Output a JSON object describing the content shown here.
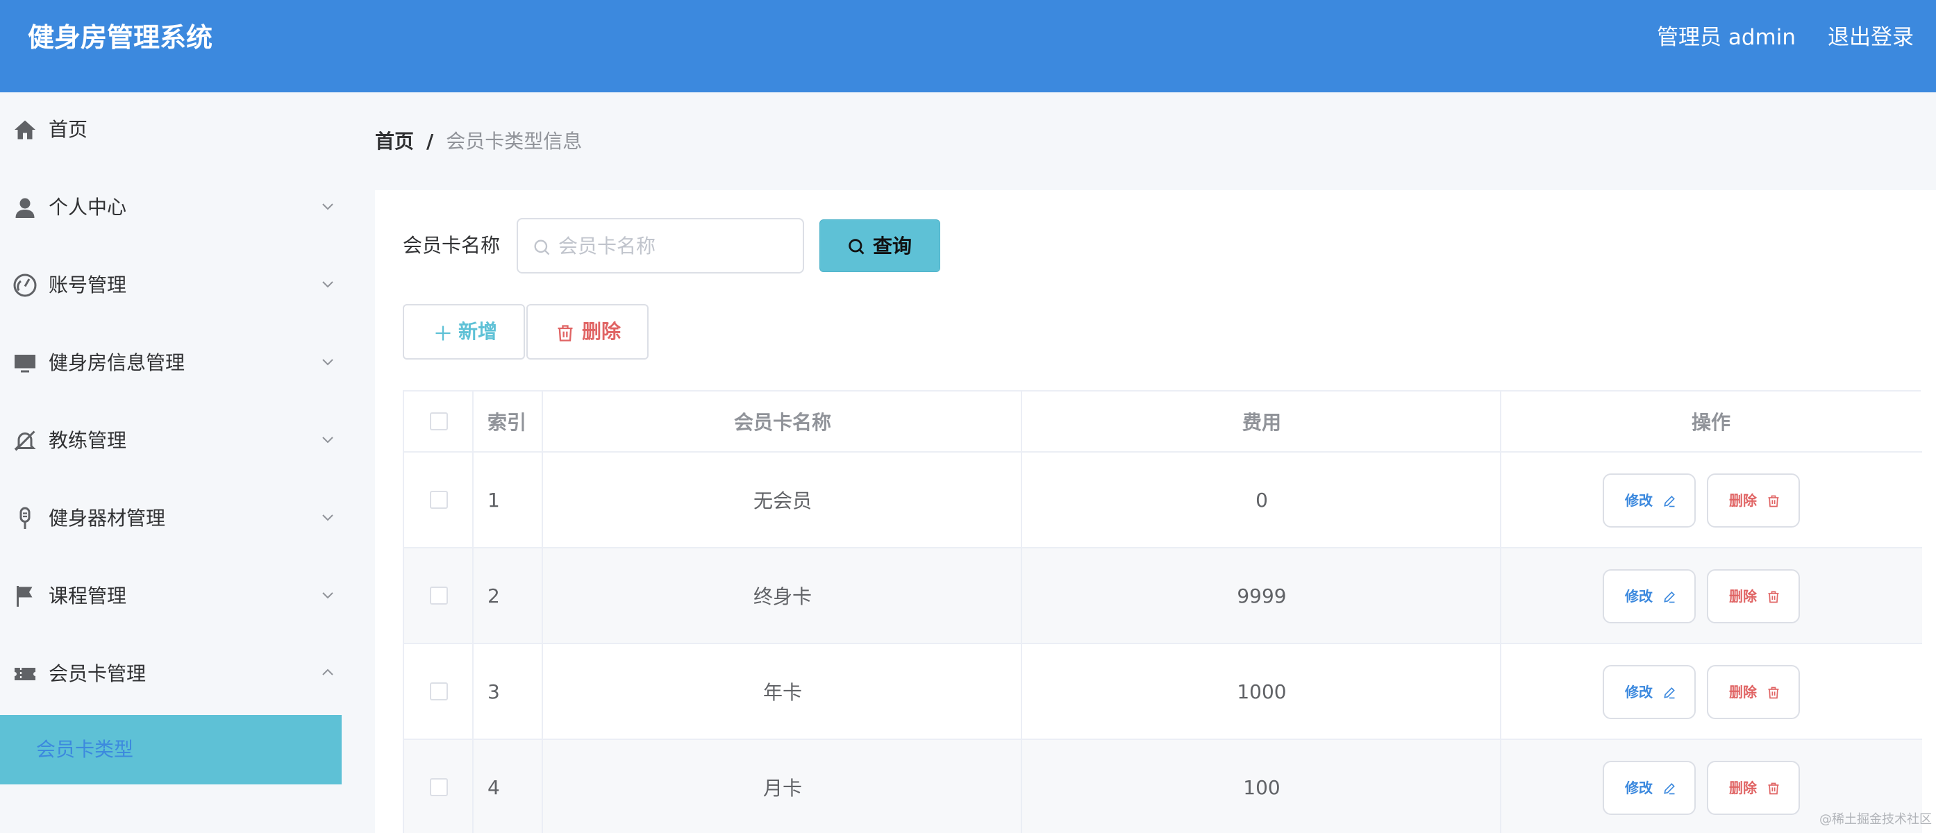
{
  "header": {
    "app_title": "健身房管理系统",
    "admin_label": "管理员 admin",
    "logout_label": "退出登录"
  },
  "sidebar": {
    "items": [
      {
        "label": "首页",
        "icon": "home-icon",
        "expandable": false
      },
      {
        "label": "个人中心",
        "icon": "user-icon",
        "expandable": true
      },
      {
        "label": "账号管理",
        "icon": "odometer-icon",
        "expandable": true
      },
      {
        "label": "健身房信息管理",
        "icon": "monitor-icon",
        "expandable": true
      },
      {
        "label": "教练管理",
        "icon": "bell-off-icon",
        "expandable": true
      },
      {
        "label": "健身器材管理",
        "icon": "microphone-icon",
        "expandable": true
      },
      {
        "label": "课程管理",
        "icon": "flag-icon",
        "expandable": true
      },
      {
        "label": "会员卡管理",
        "icon": "ticket-icon",
        "expandable": true,
        "expanded": true
      }
    ],
    "active_subitem": "会员卡类型"
  },
  "breadcrumb": {
    "home": "首页",
    "separator": "/",
    "current": "会员卡类型信息"
  },
  "search": {
    "label": "会员卡名称",
    "placeholder": "会员卡名称",
    "value": "",
    "query_label": "查询"
  },
  "actions": {
    "add_label": "新增",
    "delete_label": "删除"
  },
  "table": {
    "columns": [
      "",
      "索引",
      "会员卡名称",
      "费用",
      "操作"
    ],
    "rows": [
      {
        "index": "1",
        "name": "无会员",
        "fee": "0"
      },
      {
        "index": "2",
        "name": "终身卡",
        "fee": "9999"
      },
      {
        "index": "3",
        "name": "年卡",
        "fee": "1000"
      },
      {
        "index": "4",
        "name": "月卡",
        "fee": "100"
      }
    ],
    "edit_label": "修改",
    "delete_label": "删除"
  },
  "watermark": "@稀土掘金技术社区",
  "colors": {
    "header_bg": "#3c89de",
    "accent_teal": "#5ec1d6",
    "danger": "#e06464",
    "link_blue": "#3c89de"
  }
}
